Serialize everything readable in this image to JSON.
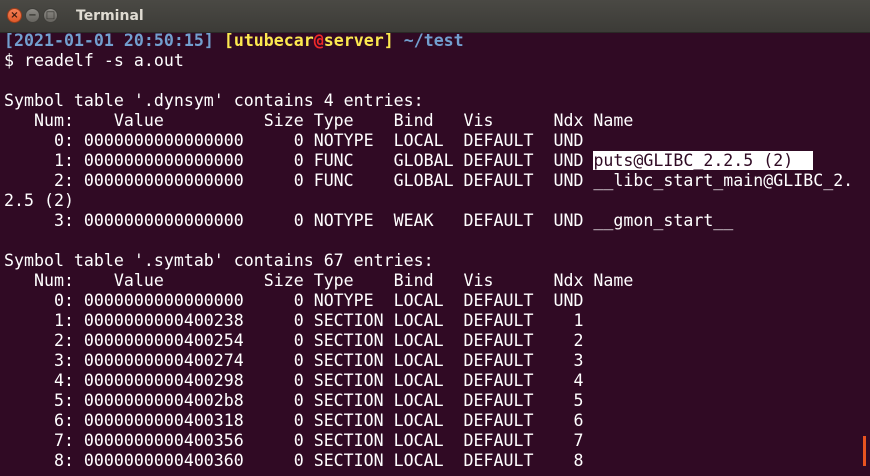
{
  "window": {
    "title": "Terminal",
    "close_glyph": "×",
    "minimize_glyph": "−",
    "maximize_glyph": "□"
  },
  "prompt": {
    "open_bracket": "[",
    "datetime": "2021-01-01 20:50:15",
    "close_bracket": "]",
    "space1": " ",
    "bracket2_open": "[",
    "user": "utubecar",
    "at": "@",
    "host": "server",
    "bracket2_close": "]",
    "space2": " ",
    "path": "~/test",
    "command": "$ readelf -s a.out"
  },
  "dynsym": {
    "heading": "Symbol table '.dynsym' contains 4 entries:",
    "header": "   Num:    Value          Size Type    Bind   Vis      Ndx Name",
    "rows": [
      "     0: 0000000000000000     0 NOTYPE  LOCAL  DEFAULT  UND ",
      "     2: 0000000000000000     0 FUNC    GLOBAL DEFAULT  UND __libc_start_main@GLIBC_2.",
      "2.5 (2)",
      "     3: 0000000000000000     0 NOTYPE  WEAK   DEFAULT  UND __gmon_start__"
    ],
    "selected_row_prefix": "     1: 0000000000000000     0 FUNC    GLOBAL DEFAULT  UND ",
    "selected_text": "puts@GLIBC_2.2.5 (2)  "
  },
  "symtab": {
    "heading": "Symbol table '.symtab' contains 67 entries:",
    "header": "   Num:    Value          Size Type    Bind   Vis      Ndx Name",
    "rows": [
      "     0: 0000000000000000     0 NOTYPE  LOCAL  DEFAULT  UND ",
      "     1: 0000000000400238     0 SECTION LOCAL  DEFAULT    1 ",
      "     2: 0000000000400254     0 SECTION LOCAL  DEFAULT    2 ",
      "     3: 0000000000400274     0 SECTION LOCAL  DEFAULT    3 ",
      "     4: 0000000000400298     0 SECTION LOCAL  DEFAULT    4 ",
      "     5: 00000000004002b8     0 SECTION LOCAL  DEFAULT    5 ",
      "     6: 0000000000400318     0 SECTION LOCAL  DEFAULT    6 ",
      "     7: 0000000000400356     0 SECTION LOCAL  DEFAULT    7 ",
      "     8: 0000000000400360     0 SECTION LOCAL  DEFAULT    8 "
    ]
  },
  "colors": {
    "background": "#300a24",
    "foreground": "#ffffff",
    "prompt_blue": "#729fcf",
    "prompt_yellow": "#fce94f",
    "prompt_red": "#ef2929",
    "scroll_accent": "#e95420"
  }
}
